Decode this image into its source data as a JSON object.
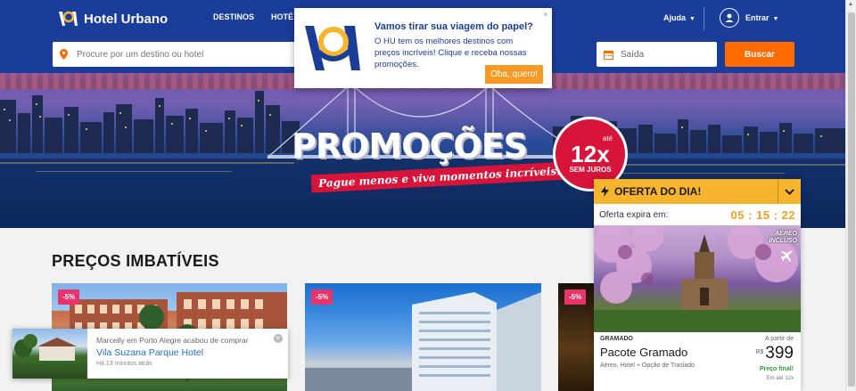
{
  "header": {
    "logo_text": "Hotel Urbano",
    "nav": [
      "DESTINOS",
      "HOTÉ"
    ],
    "help": "Ajuda",
    "login": "Entrar"
  },
  "search": {
    "destination_placeholder": "Procure por um destino ou hotel",
    "checkout_label": "Saída",
    "submit": "Buscar"
  },
  "hero": {
    "title": "PROMOÇÕES",
    "subtitle": "Pague menos e viva momentos incríveis.",
    "badge_pre": "até",
    "badge_main": "12x",
    "badge_sub": "SEM JUROS"
  },
  "section": {
    "title": "PREÇOS IMBATÍVEIS"
  },
  "cards": [
    {
      "discount": "-5%"
    },
    {
      "discount": "-5%"
    },
    {
      "discount": "-5%"
    }
  ],
  "offer": {
    "title": "OFERTA DO DIA!",
    "expires_label": "Oferta expira em:",
    "countdown": "05 : 15 : 22",
    "badge_line1": "AÉREO",
    "badge_line2": "INCLUSO",
    "city": "GRAMADO",
    "name": "Pacote Gramado",
    "description": "Aéreo, Hotel + Opção de Traslado",
    "from_label": "A partir de",
    "currency": "R$",
    "price": "399",
    "final_label": "Preço final!",
    "installments": "Em até 12x"
  },
  "popup": {
    "title": "Vamos tirar sua viagem do papel?",
    "text": "O HU tem os melhores destinos com preços incríveis! Clique e receba nossas promoções.",
    "cta": "Oba, quero!",
    "close": "×"
  },
  "toast": {
    "line1": "Marcelly em Porto Alegre acabou de comprar",
    "hotel": "Vila Suzana Parque Hotel",
    "time": "Há 13 minutos atrás",
    "close": "×"
  },
  "colors": {
    "brand_blue": "#1b3d9a",
    "cta_orange": "#ff6b00",
    "offer_yellow": "#f6b52c",
    "discount_pink": "#e8336b"
  }
}
